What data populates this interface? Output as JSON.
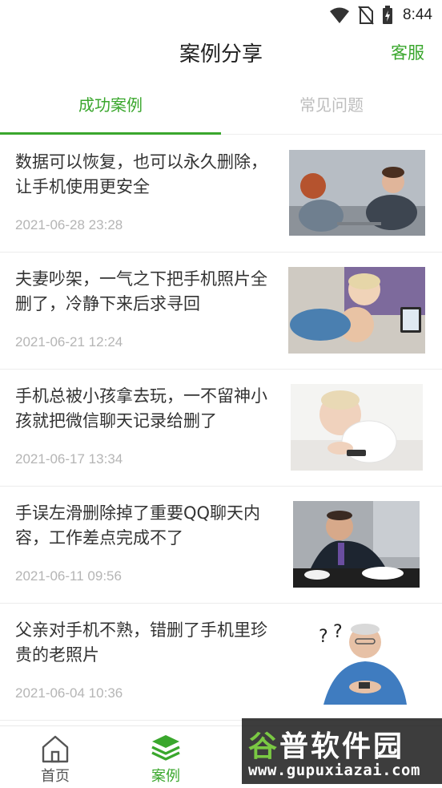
{
  "status_bar": {
    "time": "8:44"
  },
  "header": {
    "title": "案例分享",
    "action": "客服"
  },
  "tabs": [
    {
      "label": "成功案例",
      "active": true
    },
    {
      "label": "常见问题",
      "active": false
    }
  ],
  "articles": [
    {
      "title": "数据可以恢复，也可以永久删除，让手机使用更安全",
      "date": "2021-06-28 23:28"
    },
    {
      "title": "夫妻吵架，一气之下把手机照片全删了，冷静下来后求寻回",
      "date": "2021-06-21 12:24"
    },
    {
      "title": "手机总被小孩拿去玩，一不留神小孩就把微信聊天记录给删了",
      "date": "2021-06-17 13:34"
    },
    {
      "title": "手误左滑删除掉了重要QQ聊天内容，工作差点完成不了",
      "date": "2021-06-11 09:56"
    },
    {
      "title": "父亲对手机不熟，错删了手机里珍贵的老照片",
      "date": "2021-06-04 10:36"
    }
  ],
  "bottom_nav": [
    {
      "label": "首页",
      "icon": "home-icon",
      "active": false
    },
    {
      "label": "案例",
      "icon": "layers-icon",
      "active": true
    }
  ],
  "watermark": {
    "logo_text": "谷普软件园",
    "url": "www.gupuxiazai.com"
  },
  "colors": {
    "accent": "#3aa72d",
    "muted_text": "#b5b5b5",
    "divider": "#ececec"
  }
}
